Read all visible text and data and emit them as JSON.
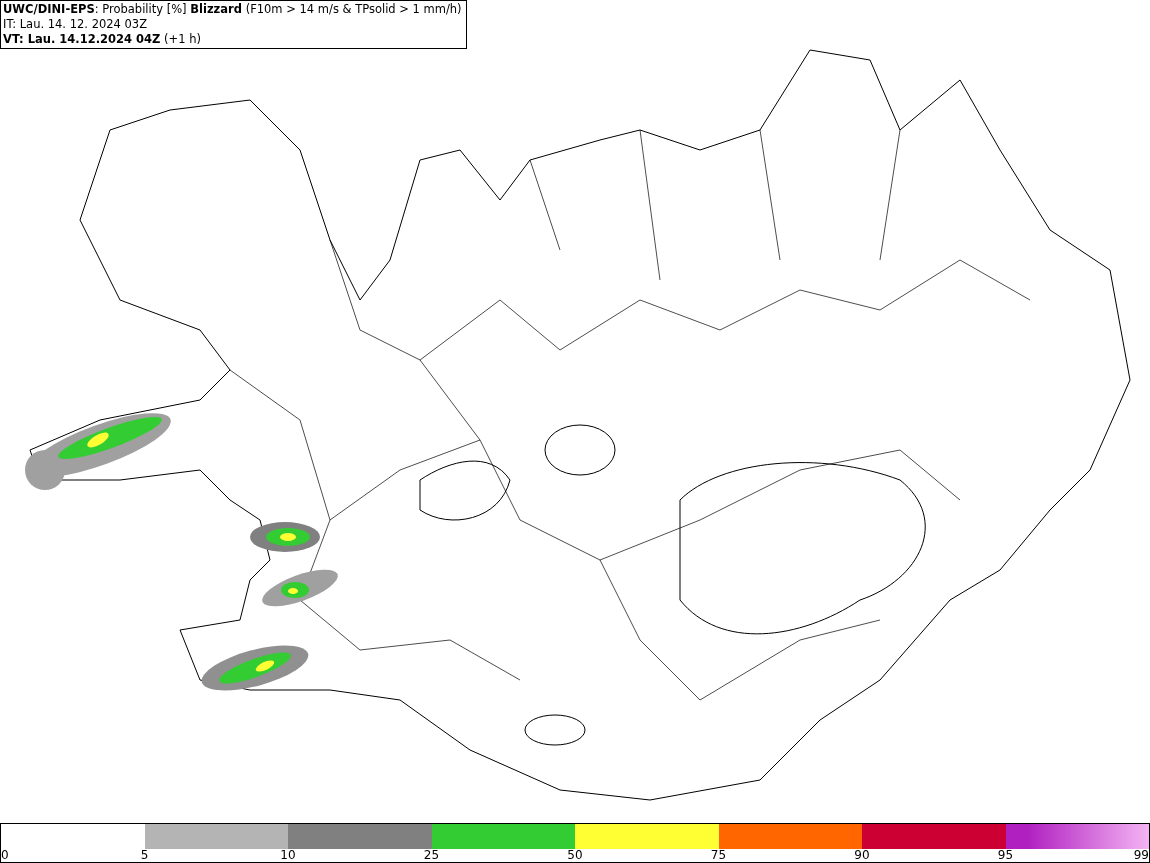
{
  "header": {
    "title": "**UWC/DINI-EPS**: Probability [%] **Blizzard** (F10m > 14 m/s & TPsolid > 1 mm/h)",
    "initial_time": "IT: Lau. 14. 12. 2024 03Z",
    "valid_time": "**VT: Lau. 14.12.2024 04Z** (+1 h)"
  },
  "legend": {
    "start_label": "0",
    "bins": [
      {
        "label": "5"
      },
      {
        "label": "10",
        "color": "#b4b4b4"
      },
      {
        "label": "25",
        "color": "#808080"
      },
      {
        "label": "50",
        "color": "#33cc33"
      },
      {
        "label": "75",
        "color": "#ffff33"
      },
      {
        "label": "90",
        "color": "#ff6600"
      },
      {
        "label": "95",
        "color": "#cc0033"
      },
      {
        "label": "99",
        "color": "#b020c0"
      }
    ]
  }
}
